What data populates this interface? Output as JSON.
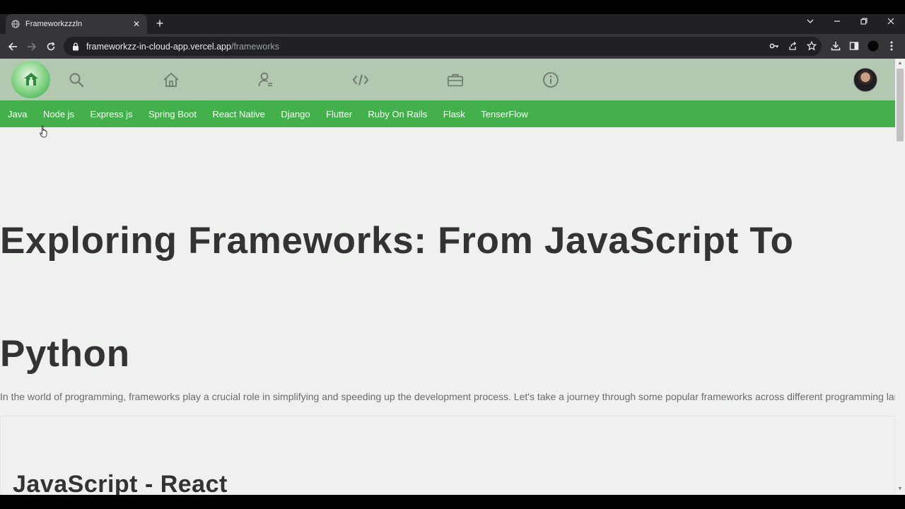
{
  "browser": {
    "tab_title": "Frameworkzzzln",
    "url_host": "frameworkzz-in-cloud-app.vercel.app",
    "url_path": "/frameworks",
    "icons": [
      "globe-icon",
      "close-icon",
      "plus-icon",
      "minimize-icon",
      "restore-icon",
      "back-icon",
      "forward-icon",
      "reload-icon",
      "lock-icon",
      "key-icon",
      "share-icon",
      "star-icon",
      "download-icon",
      "sidepanel-icon",
      "profile-icon",
      "menu-icon"
    ]
  },
  "app_nav": {
    "icons": [
      "logo",
      "search-icon",
      "home-icon",
      "user-icon",
      "code-icon",
      "briefcase-icon",
      "info-icon",
      "avatar"
    ],
    "colors": {
      "nav_bg": "#b2c8b1",
      "category_bg": "#43b04c"
    }
  },
  "categories": [
    "Java",
    "Node js",
    "Express js",
    "Spring Boot",
    "React Native",
    "Django",
    "Flutter",
    "Ruby On Rails",
    "Flask",
    "TenserFlow"
  ],
  "main": {
    "heading": "Exploring Frameworks: From JavaScript To Python",
    "intro": "In the world of programming, frameworks play a crucial role in simplifying and speeding up the development process. Let's take a journey through some popular frameworks across different programming languages.",
    "section_title": "JavaScript - React"
  }
}
